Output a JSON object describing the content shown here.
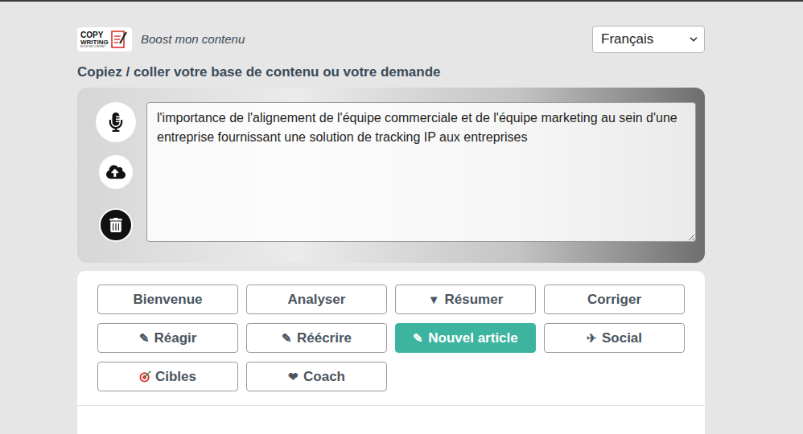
{
  "header": {
    "logo": {
      "line1": "COPY",
      "line2": "WRITING",
      "tagline": "BOOST MY CONTENT"
    },
    "subtitle": "Boost mon contenu",
    "language": "Français"
  },
  "prompt_label": "Copiez / coller votre base de contenu ou votre demande",
  "editor": {
    "text": "l'importance de l'alignement de l'équipe commerciale et de l'équipe marketing au sein d'une entreprise fournissant une solution de tracking IP aux entreprises"
  },
  "actions": [
    {
      "label": "Bienvenue",
      "icon": "",
      "kind": "plain",
      "selected": false
    },
    {
      "label": "Analyser",
      "icon": "",
      "kind": "plain",
      "selected": false
    },
    {
      "label": "Résumer",
      "icon": "▼",
      "kind": "glyph",
      "selected": false
    },
    {
      "label": "Corriger",
      "icon": "",
      "kind": "plain",
      "selected": false
    },
    {
      "label": "Réagir",
      "icon": "✎",
      "kind": "glyph",
      "selected": false
    },
    {
      "label": "Réécrire",
      "icon": "✎",
      "kind": "glyph",
      "selected": false
    },
    {
      "label": "Nouvel article",
      "icon": "✎",
      "kind": "glyph",
      "selected": true
    },
    {
      "label": "Social",
      "icon": "✈",
      "kind": "glyph",
      "selected": false
    },
    {
      "label": "Cibles",
      "icon": "",
      "kind": "target",
      "selected": false
    },
    {
      "label": "Coach",
      "icon": "❤",
      "kind": "glyph",
      "selected": false
    }
  ]
}
